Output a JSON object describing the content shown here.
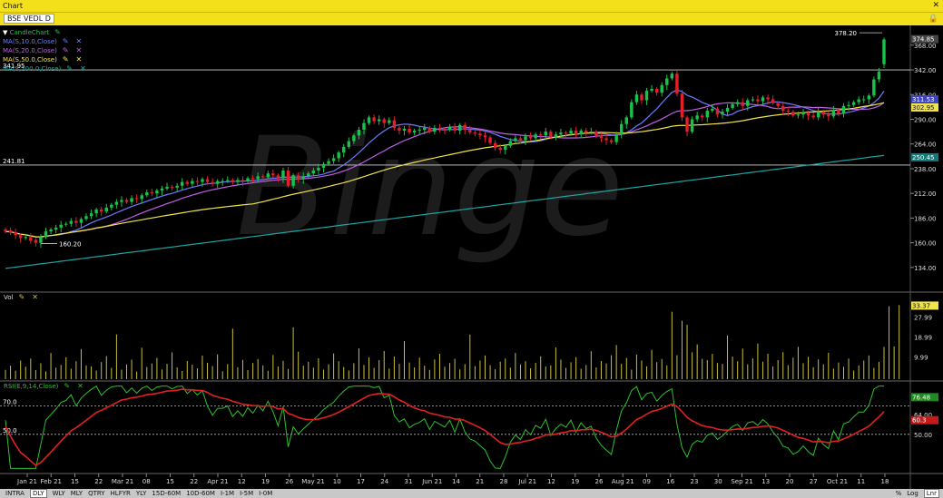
{
  "window": {
    "title": "Chart",
    "close": "✕"
  },
  "symbol": {
    "name": "BSE VEDL D",
    "lock": "🔒"
  },
  "legend": {
    "candle": "CandleChart",
    "ma": [
      {
        "label": "MA(S,10.0,Close)",
        "color": "#6f7cff"
      },
      {
        "label": "MA(S,20.0,Close)",
        "color": "#c05fe6"
      },
      {
        "label": "MA(S,50.0,Close)",
        "color": "#f1e44a"
      },
      {
        "label": "MA(S,200.0,Close)",
        "color": "#1aa7a3"
      }
    ],
    "vol": "Vol",
    "rsi": "RSI(E,9,14,Close)"
  },
  "price_panel": {
    "axis_ticks": [
      "368.00",
      "342.00",
      "316.00",
      "290.00",
      "264.00",
      "238.00",
      "212.00",
      "186.00",
      "160.00",
      "134.00"
    ],
    "top_axis_label": "374.85",
    "last_price": "302.95",
    "ma10_value": "311.53",
    "ma200_value": "250.45",
    "hline_high_label": "341.95",
    "hline_low_label": "241.81",
    "peak_label": "378.20",
    "low_label": "160.20",
    "watermark": "Binge"
  },
  "vol_panel": {
    "axis_ticks": [
      "27.99",
      "18.99",
      "9.99"
    ],
    "last_value": "33.37"
  },
  "rsi_panel": {
    "axis_ticks": [
      "64.00",
      "50.00"
    ],
    "value_green": "76.48",
    "value_red": "60.3",
    "level_high": "70.0",
    "level_low": "50.0"
  },
  "x_axis": [
    "Jan 21",
    "Feb 21",
    "15",
    "22",
    "Mar 21",
    "08",
    "15",
    "22",
    "Apr 21",
    "12",
    "19",
    "26",
    "May 21",
    "10",
    "17",
    "24",
    "31",
    "Jun 21",
    "14",
    "21",
    "28",
    "Jul 21",
    "12",
    "19",
    "26",
    "Aug 21",
    "09",
    "16",
    "23",
    "30",
    "Sep 21",
    "13",
    "20",
    "27",
    "Oct 21",
    "11",
    "18"
  ],
  "periods": [
    "INTRA",
    "DLY",
    "WLY",
    "MLY",
    "QTRY",
    "HLFYR",
    "YLY",
    "15D-60M",
    "10D-60M",
    "I-1M",
    "I-5M",
    "I-0M"
  ],
  "active_period": "DLY",
  "scale": [
    "%",
    "Log",
    "Lnr"
  ],
  "colors": {
    "up": "#19c24a",
    "down": "#e0202a",
    "vol": "#c9bf3a",
    "rsi": "#2fbf2f",
    "rsi_sig": "#e32020",
    "accent": "#f3df1a"
  },
  "chart_data": {
    "type": "candlestick",
    "price_range": [
      110,
      385
    ],
    "vol_range": [
      0,
      36
    ],
    "rsi_range": [
      25,
      85
    ],
    "close": [
      172,
      171,
      168,
      165,
      166,
      162,
      160,
      166,
      172,
      174,
      176,
      179,
      180,
      183,
      181,
      185,
      188,
      191,
      195,
      193,
      197,
      200,
      203,
      205,
      203,
      207,
      206,
      210,
      213,
      212,
      215,
      217,
      219,
      218,
      220,
      224,
      222,
      225,
      224,
      227,
      224,
      222,
      225,
      225,
      226,
      224,
      226,
      225,
      228,
      227,
      230,
      229,
      233,
      231,
      228,
      236,
      220,
      231,
      227,
      230,
      233,
      236,
      239,
      243,
      246,
      249,
      255,
      261,
      267,
      273,
      279,
      286,
      292,
      288,
      290,
      286,
      289,
      281,
      278,
      280,
      276,
      278,
      279,
      281,
      277,
      281,
      280,
      279,
      282,
      278,
      284,
      279,
      276,
      275,
      273,
      271,
      265,
      260,
      258,
      262,
      267,
      270,
      268,
      272,
      270,
      274,
      273,
      277,
      271,
      274,
      276,
      275,
      278,
      274,
      278,
      276,
      277,
      273,
      270,
      268,
      266,
      274,
      285,
      292,
      308,
      316,
      310,
      320,
      322,
      318,
      326,
      333,
      338,
      317,
      292,
      277,
      290,
      294,
      292,
      299,
      301,
      295,
      298,
      302,
      306,
      308,
      304,
      310,
      311,
      309,
      313,
      311,
      307,
      304,
      299,
      298,
      294,
      295,
      297,
      294,
      292,
      298,
      295,
      293,
      300,
      296,
      304,
      305,
      308,
      311,
      311,
      315,
      332,
      340,
      374
    ],
    "open": [
      174,
      173,
      171,
      168,
      165,
      166,
      163,
      160,
      166,
      172,
      174,
      176,
      179,
      180,
      183,
      181,
      185,
      188,
      191,
      195,
      193,
      197,
      200,
      203,
      205,
      203,
      207,
      206,
      210,
      213,
      212,
      215,
      217,
      219,
      218,
      220,
      224,
      222,
      225,
      224,
      227,
      224,
      222,
      225,
      225,
      226,
      224,
      226,
      225,
      228,
      227,
      230,
      229,
      233,
      231,
      228,
      236,
      220,
      231,
      227,
      230,
      233,
      236,
      239,
      243,
      246,
      249,
      255,
      261,
      267,
      273,
      279,
      286,
      292,
      288,
      290,
      286,
      289,
      281,
      278,
      280,
      276,
      278,
      279,
      281,
      277,
      281,
      280,
      279,
      282,
      278,
      284,
      279,
      276,
      275,
      273,
      271,
      265,
      260,
      258,
      262,
      267,
      270,
      268,
      272,
      270,
      274,
      273,
      277,
      271,
      274,
      276,
      275,
      278,
      274,
      278,
      276,
      277,
      273,
      270,
      268,
      266,
      274,
      285,
      292,
      308,
      316,
      310,
      320,
      322,
      318,
      326,
      333,
      338,
      317,
      292,
      277,
      290,
      294,
      292,
      299,
      301,
      295,
      298,
      302,
      306,
      308,
      304,
      310,
      311,
      309,
      313,
      311,
      307,
      304,
      299,
      298,
      294,
      295,
      297,
      294,
      292,
      298,
      295,
      293,
      300,
      296,
      304,
      305,
      308,
      311,
      311,
      315,
      332,
      348
    ],
    "volume": [
      4.2,
      6.1,
      3.8,
      8.4,
      5.6,
      9.3,
      4.1,
      7.2,
      3.5,
      11.8,
      5.2,
      6.4,
      9.9,
      4.7,
      8.1,
      13.6,
      6.2,
      5.8,
      3.9,
      7.7,
      10.4,
      5.1,
      20.2,
      4.3,
      6.6,
      8.8,
      3.4,
      14.2,
      5.5,
      7.1,
      9.6,
      4.4,
      6.9,
      12.1,
      5.3,
      3.7,
      8.2,
      6.5,
      4.9,
      10.6,
      7.4,
      5.9,
      11.2,
      3.6,
      6.8,
      22.8,
      5.4,
      8.7,
      4.1,
      7.3,
      9.1,
      6.2,
      3.8,
      10.9,
      5.7,
      8.3,
      4.6,
      23.4,
      12.4,
      6.1,
      7.8,
      5.2,
      9.4,
      4.3,
      6.7,
      11.6,
      8.1,
      5.5,
      3.9,
      7.2,
      13.9,
      6.4,
      9.8,
      5.1,
      8.6,
      12.7,
      4.8,
      10.2,
      6.9,
      17.2,
      7.5,
      5.3,
      9.7,
      6.1,
      4.2,
      8.9,
      11.4,
      5.6,
      7.3,
      9.2,
      4.4,
      6.8,
      20.1,
      5.9,
      8.4,
      10.7,
      6.3,
      4.5,
      7.9,
      9.3,
      5.2,
      11.8,
      6.6,
      8.1,
      4.9,
      7.4,
      10.3,
      5.7,
      6.2,
      14.3,
      8.8,
      5.1,
      7.6,
      9.9,
      4.7,
      6.4,
      12.6,
      5.3,
      8.2,
      7.1,
      10.8,
      15.4,
      6.9,
      9.6,
      4.3,
      11.1,
      8.4,
      5.8,
      13.2,
      7.7,
      9.1,
      6.2,
      30.4,
      10.8,
      26.3,
      24.5,
      12.1,
      15.7,
      9.2,
      8.6,
      11.4,
      7.3,
      6.9,
      19.7,
      10.2,
      8.1,
      13.8,
      6.7,
      9.4,
      16.1,
      7.9,
      11.5,
      5.8,
      8.6,
      12.2,
      6.3,
      9.7,
      14.6,
      7.2,
      10.1,
      5.4,
      8.9,
      6.7,
      11.9,
      4.8,
      7.5,
      5.6,
      9.3,
      3.9,
      6.2,
      8.4,
      10.7,
      5.1,
      7.8,
      14.5,
      32.9,
      14.8,
      33.4
    ]
  }
}
